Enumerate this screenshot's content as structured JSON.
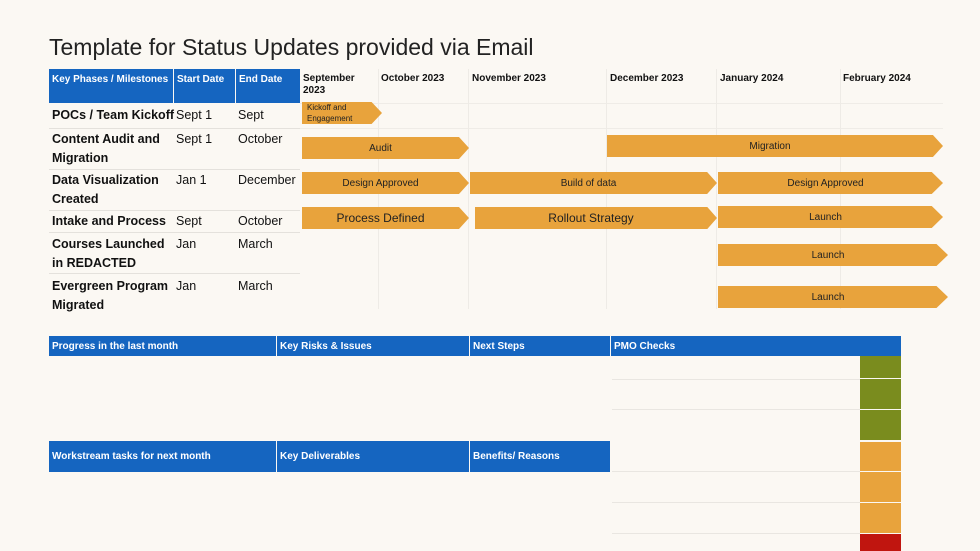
{
  "title": "Template for Status Updates provided via Email",
  "table_headers": {
    "phase": "Key Phases / Milestones",
    "start": "Start Date",
    "end": "End Date"
  },
  "months": [
    "September\n2023",
    "October 2023",
    "November 2023",
    "December 2023",
    "January 2024",
    "February 2024"
  ],
  "rows": [
    {
      "phase": "POCs / Team Kickoff",
      "start": "Sept 1",
      "end": "Sept"
    },
    {
      "phase": "Content Audit and Migration",
      "start": "Sept 1",
      "end": "October"
    },
    {
      "phase": "Data Visualization Created",
      "start": "Jan 1",
      "end": "December"
    },
    {
      "phase": "Intake and Process",
      "start": "Sept",
      "end": "October"
    },
    {
      "phase": "Courses Launched in REDACTED",
      "start": "Jan",
      "end": "March"
    },
    {
      "phase": "Evergreen Program Migrated",
      "start": "Jan",
      "end": "March"
    }
  ],
  "bars": {
    "kickoff": "Kickoff and Engagement",
    "audit": "Audit",
    "migration": "Migration",
    "design_approved_1": "Design Approved",
    "build_of_data": "Build of data",
    "design_approved_2": "Design Approved",
    "process_defined": "Process Defined",
    "rollout_strategy": "Rollout Strategy",
    "launch_1": "Launch",
    "launch_2": "Launch",
    "launch_3": "Launch"
  },
  "bottom_headers": {
    "progress": "Progress in the last month",
    "risks": "Key Risks & Issues",
    "next_steps": "Next Steps",
    "pmo_checks": "PMO Checks",
    "workstream": "Workstream tasks for next month",
    "deliverables": "Key Deliverables",
    "benefits": "Benefits/ Reasons"
  },
  "colors": {
    "header_blue": "#1565c0",
    "bar_orange": "#e8a33c",
    "status_green": "#7a8c1e",
    "status_amber": "#e8a33c",
    "status_red": "#c0150f"
  },
  "pmo_status": [
    "green",
    "green",
    "green",
    "amber",
    "amber",
    "amber",
    "red"
  ]
}
